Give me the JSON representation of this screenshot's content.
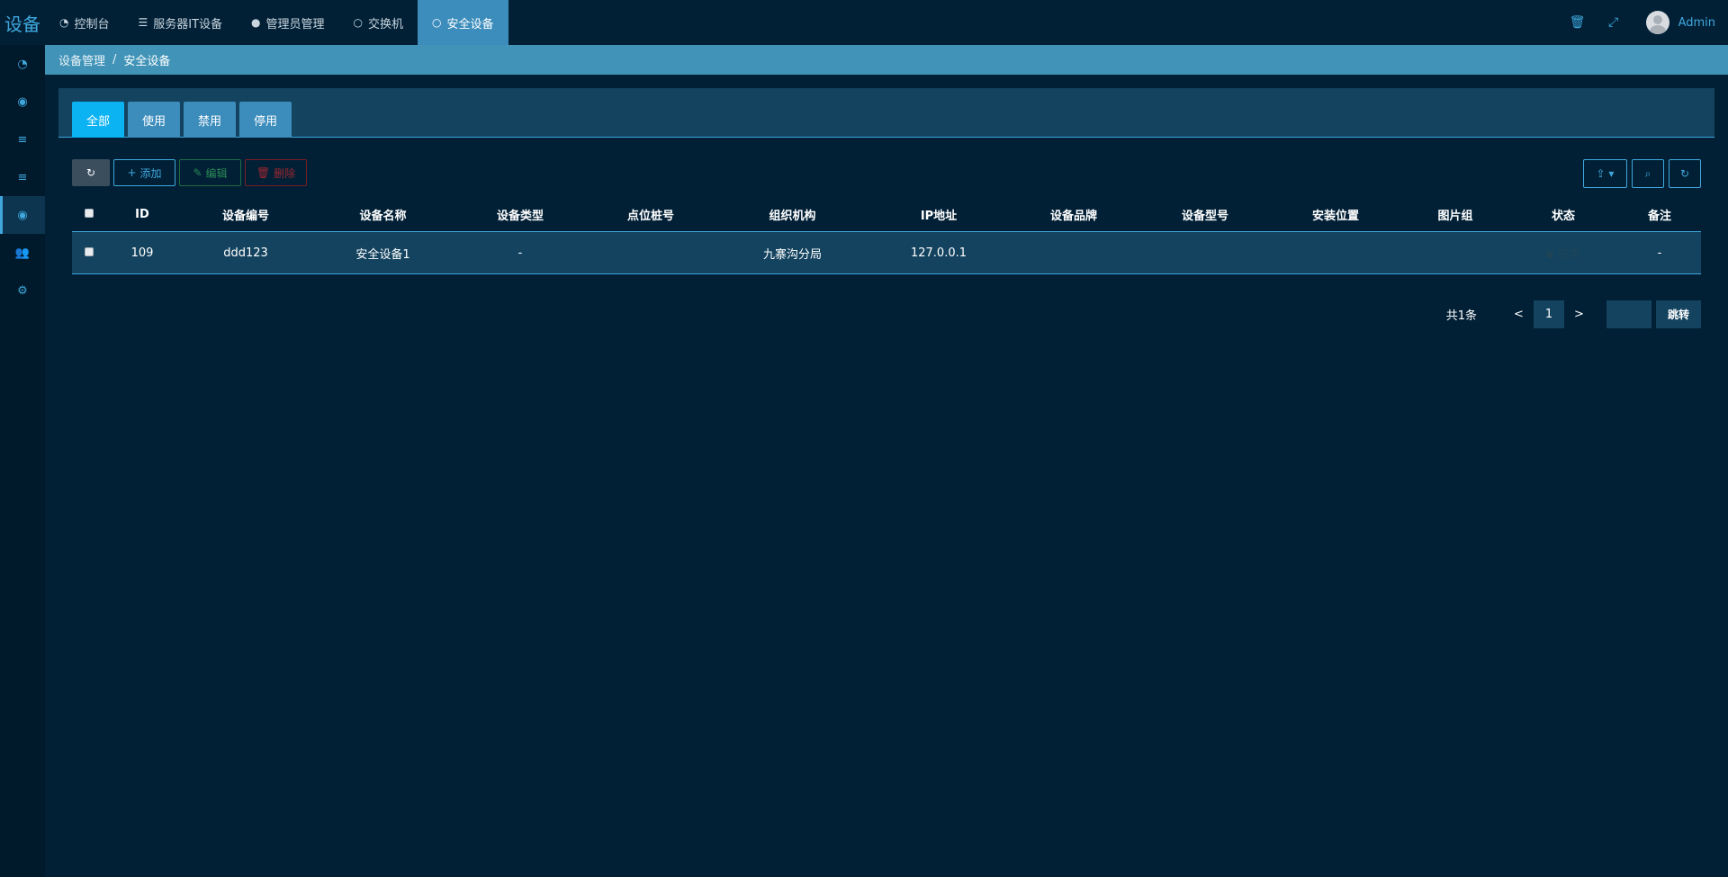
{
  "brand": "设备",
  "nav": {
    "items": [
      {
        "label": "控制台",
        "icon": "dashboard-icon"
      },
      {
        "label": "服务器IT设备",
        "icon": "server-icon"
      },
      {
        "label": "管理员管理",
        "icon": "user-icon"
      },
      {
        "label": "交换机",
        "icon": "circle-icon"
      },
      {
        "label": "安全设备",
        "icon": "circle-icon",
        "active": true
      }
    ]
  },
  "user": {
    "name": "Admin"
  },
  "breadcrumb": {
    "parent": "设备管理",
    "separator": "/",
    "current": "安全设备"
  },
  "tabs": [
    "全部",
    "使用",
    "禁用",
    "停用"
  ],
  "toolbar": {
    "add": "添加",
    "edit": "编辑",
    "delete": "删除"
  },
  "table": {
    "headers": [
      "ID",
      "设备编号",
      "设备名称",
      "设备类型",
      "点位桩号",
      "组织机构",
      "IP地址",
      "设备品牌",
      "设备型号",
      "安装位置",
      "图片组",
      "状态",
      "备注"
    ],
    "rows": [
      {
        "id": "109",
        "code": "ddd123",
        "name": "安全设备1",
        "type": "-",
        "pile": "",
        "org": "九寨沟分局",
        "ip": "127.0.0.1",
        "brand": "",
        "model": "",
        "location": "",
        "images": "",
        "status": "正常",
        "remark": "-"
      }
    ]
  },
  "pagination": {
    "total": "共1条",
    "prev": "<",
    "page": "1",
    "next": ">",
    "go": "跳转"
  },
  "colors": {
    "background": "#012036",
    "accent": "#3fa7dc",
    "active_tab": "#0bb3f3",
    "panel": "#13435f"
  }
}
